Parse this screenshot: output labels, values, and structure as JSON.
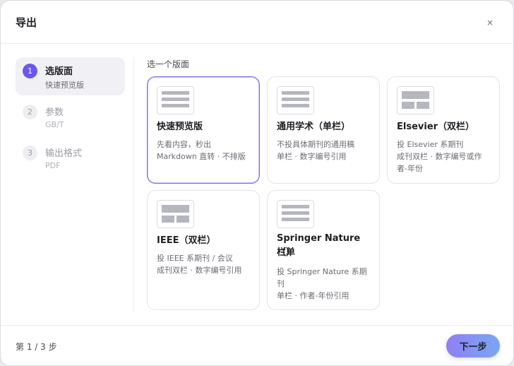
{
  "dialog": {
    "title": "导出",
    "close_label": "×"
  },
  "steps": [
    {
      "number": "1",
      "label": "选版面",
      "sub": "快速预览版",
      "active": true
    },
    {
      "number": "2",
      "label": "参数",
      "sub": "GB/T",
      "active": false
    },
    {
      "number": "3",
      "label": "输出格式",
      "sub": "PDF",
      "active": false
    }
  ],
  "section_label": "选一个版面",
  "cards": [
    {
      "title": "快速预览版",
      "desc_lines": [
        "先看内容，秒出",
        "Markdown 直转 · 不排版"
      ],
      "layout": "single-column",
      "selected": true
    },
    {
      "title": "通用学术（单栏）",
      "desc_lines": [
        "不投具体期刊的通用稿",
        "单栏 · 数字编号引用"
      ],
      "layout": "single-column",
      "selected": false
    },
    {
      "title": "Elsevier（双栏）",
      "desc_lines": [
        "投 Elsevier 系期刊",
        "成刊双栏 · 数字编号或作",
        "者-年份"
      ],
      "layout": "two-column",
      "selected": false
    },
    {
      "title": "IEEE（双栏）",
      "desc_lines": [
        "投 IEEE 系期刊 / 会议",
        "成刊双栏 · 数字编号引用"
      ],
      "layout": "two-column",
      "selected": false
    },
    {
      "title_lines": [
        "Springer Nature（单",
        "栏）"
      ],
      "desc_lines": [
        "投 Springer Nature 系期",
        "刊",
        "单栏 · 作者-年份引用"
      ],
      "layout": "single-column",
      "selected": false
    }
  ],
  "footer": {
    "page_indicator": "第 1 / 3 步",
    "next_label": "下一步"
  },
  "colors": {
    "accent": "#6a57f0",
    "selected_border": "#7a6cf0",
    "button_gradient_start": "#8e80f4",
    "button_gradient_end": "#7ba6f2"
  }
}
